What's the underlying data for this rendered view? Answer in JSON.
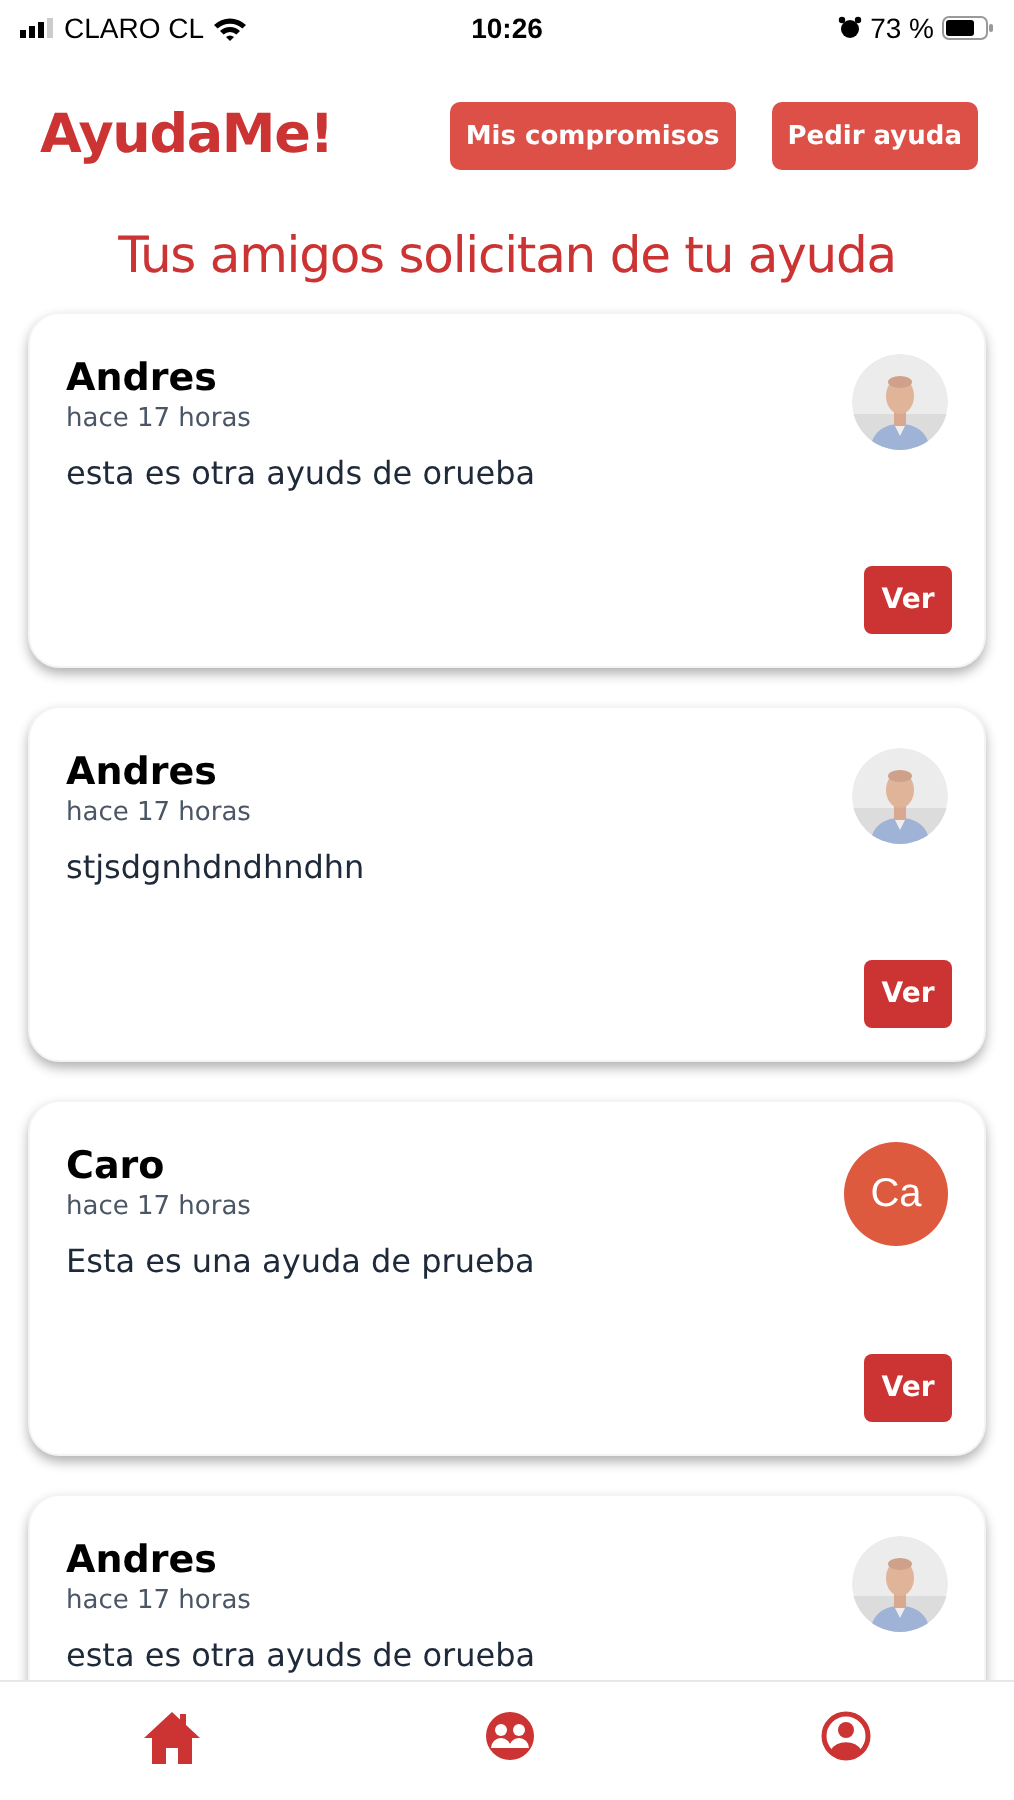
{
  "status_bar": {
    "carrier": "CLARO CL",
    "time": "10:26",
    "battery": "73 %"
  },
  "header": {
    "logo": "AyudaMe!",
    "buttons": [
      "Mis compromisos",
      "Pedir ayuda"
    ]
  },
  "title": "Tus amigos solicitan de tu ayuda",
  "requests": [
    {
      "name": "Andres",
      "time": "hace 17 horas",
      "text": "esta es otra ayuds de orueba",
      "button": "Ver"
    },
    {
      "name": "Andres",
      "time": "hace 17 horas",
      "text": "stjsdgnhdndhndhn",
      "button": "Ver"
    },
    {
      "name": "Caro",
      "time": "hace 17 horas",
      "text": "Esta es una ayuda de prueba",
      "avatar": {
        "kind": "initials",
        "initials": "Ca"
      },
      "button": "Ver"
    },
    {
      "name": "Andres",
      "time": "hace 17 horas",
      "text": "esta es otra ayuds de orueba"
    }
  ]
}
